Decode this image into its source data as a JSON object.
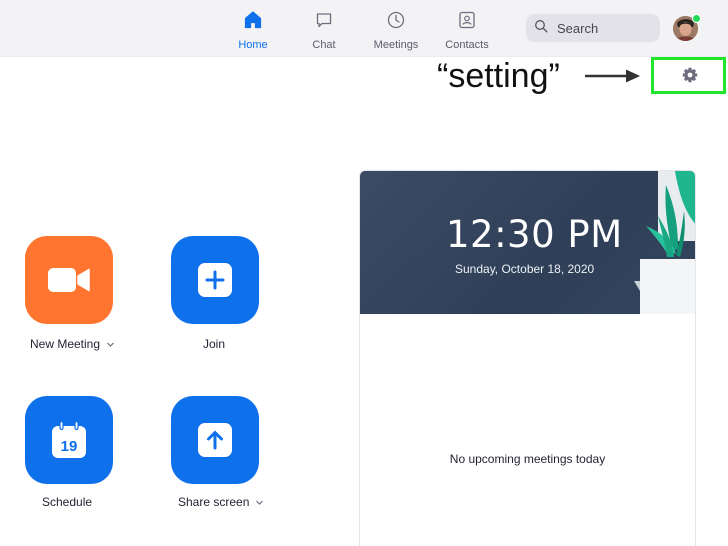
{
  "nav": {
    "items": [
      {
        "label": "Home",
        "icon": "home-icon",
        "active": true
      },
      {
        "label": "Chat",
        "icon": "chat-bubble-icon",
        "active": false
      },
      {
        "label": "Meetings",
        "icon": "clock-icon",
        "active": false
      },
      {
        "label": "Contacts",
        "icon": "contact-card-icon",
        "active": false
      }
    ],
    "search_placeholder": "Search",
    "avatar_status": "online"
  },
  "annotation": {
    "text": "“setting”",
    "highlight_color": "#1fe52b"
  },
  "actions": [
    {
      "label": "New Meeting",
      "icon": "video-camera-icon",
      "color": "#ff742e",
      "has_dropdown": true
    },
    {
      "label": "Join",
      "icon": "plus-icon",
      "color": "#0e71eb",
      "has_dropdown": false
    },
    {
      "label": "Schedule",
      "icon": "calendar-icon",
      "calendar_day": "19",
      "color": "#0e71eb",
      "has_dropdown": false
    },
    {
      "label": "Share screen",
      "icon": "upload-arrow-icon",
      "color": "#0e71eb",
      "has_dropdown": true
    }
  ],
  "card": {
    "time": "12:30 PM",
    "date": "Sunday, October 18, 2020",
    "empty_message": "No upcoming meetings today"
  },
  "colors": {
    "accent": "#0e71eb",
    "orange": "#ff742e",
    "hero_bg": "#34455e"
  }
}
